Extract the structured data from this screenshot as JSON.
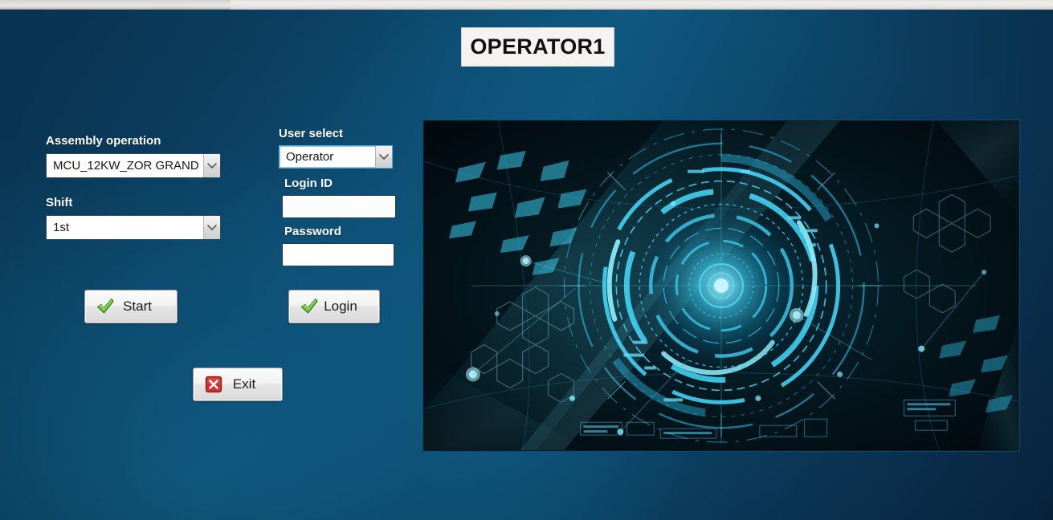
{
  "window": {
    "chrome_strip": ""
  },
  "header": {
    "title": "OPERATOR1"
  },
  "left_panel": {
    "assembly_label": "Assembly operation",
    "assembly_value": "MCU_12KW_ZOR GRAND",
    "assembly_options": [
      "MCU_12KW_ZOR GRAND"
    ],
    "shift_label": "Shift",
    "shift_value": "1st",
    "shift_options": [
      "1st"
    ],
    "start_button": "Start",
    "start_icon": "green-check-icon",
    "exit_button": "Exit",
    "exit_icon": "red-x-icon"
  },
  "login_panel": {
    "user_select_label": "User select",
    "user_select_value": "Operator",
    "user_select_options": [
      "Operator"
    ],
    "login_id_label": "Login ID",
    "login_id_value": "",
    "login_id_placeholder": "",
    "password_label": "Password",
    "password_value": "",
    "password_placeholder": "",
    "login_button": "Login",
    "login_icon": "green-check-icon"
  },
  "hero": {
    "alt": "abstract cyan technology hud circular interface artwork"
  },
  "status": {
    "bottom_residue": ""
  },
  "colors": {
    "bg_dark_navy": "#0b3a5c",
    "bg_mid_blue": "#0f5880",
    "bg_deep_navy": "#0a2540",
    "accent_cyan": "#2fd0f5",
    "title_plate_bg": "#f4f3f1",
    "button_face": "#e6e6e6",
    "check_green": "#5aab2d",
    "exit_red": "#cf2b2b"
  }
}
